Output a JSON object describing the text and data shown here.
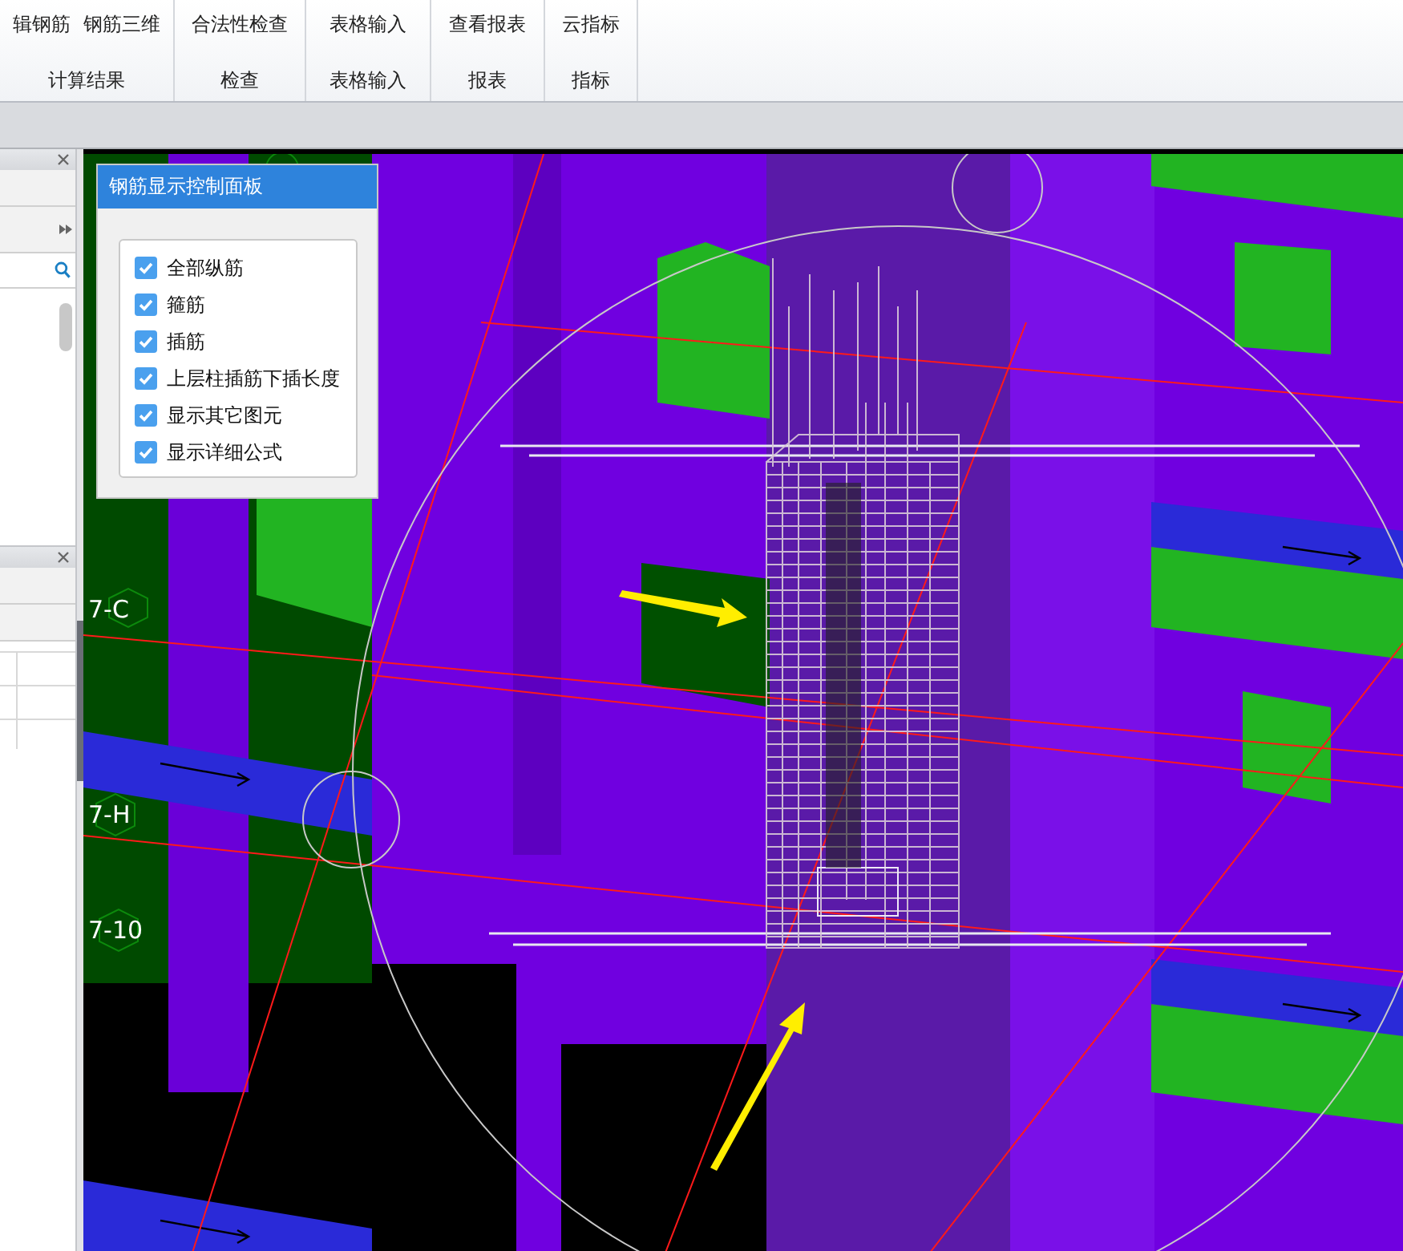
{
  "ribbon": {
    "groups": [
      {
        "buttons": [
          "辑钢筋",
          "钢筋三维"
        ],
        "label": "计算结果"
      },
      {
        "buttons": [
          "合法性检查"
        ],
        "label": "检查"
      },
      {
        "buttons": [
          "表格输入"
        ],
        "label": "表格输入"
      },
      {
        "buttons": [
          "查看报表"
        ],
        "label": "报表"
      },
      {
        "buttons": [
          "云指标"
        ],
        "label": "指标"
      }
    ]
  },
  "viewport": {
    "axis_labels": [
      "7-C",
      "7-H",
      "7-10"
    ]
  },
  "rebar_panel": {
    "title": "钢筋显示控制面板",
    "options": [
      {
        "label": "全部纵筋",
        "checked": true
      },
      {
        "label": "箍筋",
        "checked": true
      },
      {
        "label": "插筋",
        "checked": true
      },
      {
        "label": "上层柱插筋下插长度",
        "checked": true
      },
      {
        "label": "显示其它图元",
        "checked": true
      },
      {
        "label": "显示详细公式",
        "checked": true
      }
    ]
  }
}
